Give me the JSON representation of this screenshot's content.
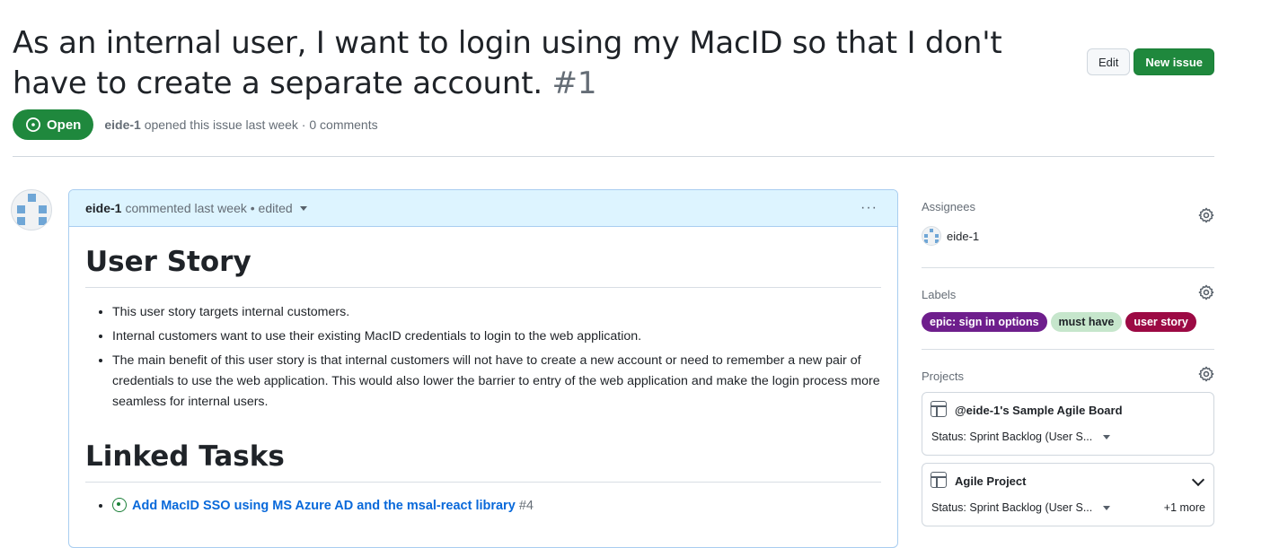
{
  "issue": {
    "title": "As an internal user, I want to login using my MacID so that I don't have to create a separate account.",
    "number": "#1",
    "state": "Open",
    "author": "eide-1",
    "meta_suffix": " opened this issue last week · 0 comments"
  },
  "header_actions": {
    "edit_label": "Edit",
    "new_issue_label": "New issue"
  },
  "comment": {
    "author": "eide-1",
    "meta": "commented last week • edited",
    "more_label": "···",
    "heading_1": "User Story",
    "bullets": [
      "This user story targets internal customers.",
      "Internal customers want to use their existing MacID credentials to login to the web application.",
      "The main benefit of this user story is that internal customers will not have to create a new account or need to remember a new pair of credentials to use the web application. This would also lower the barrier to entry of the web application and make the login process more seamless for internal users."
    ],
    "heading_2": "Linked Tasks",
    "tasks": [
      {
        "title": "Add MacID SSO using MS Azure AD and the msal-react library",
        "number": "#4"
      }
    ]
  },
  "sidebar": {
    "assignees": {
      "title": "Assignees",
      "items": [
        {
          "name": "eide-1"
        }
      ]
    },
    "labels": {
      "title": "Labels",
      "items": [
        {
          "name": "epic: sign in options",
          "bg": "#6e1e8c",
          "fg": "#ffffff"
        },
        {
          "name": "must have",
          "bg": "#c6e6cc",
          "fg": "#1f2328"
        },
        {
          "name": "user story",
          "bg": "#9c0a44",
          "fg": "#ffffff"
        }
      ]
    },
    "projects": {
      "title": "Projects",
      "items": [
        {
          "name": "@eide-1's Sample Agile Board",
          "status": "Status: Sprint Backlog (User S...",
          "more": ""
        },
        {
          "name": "Agile Project",
          "status": "Status: Sprint Backlog (User S...",
          "more": "+1 more"
        }
      ]
    }
  },
  "colors": {
    "accent_green": "#1f883d",
    "link_blue": "#0969da",
    "comment_header_bg": "#ddf4ff"
  }
}
